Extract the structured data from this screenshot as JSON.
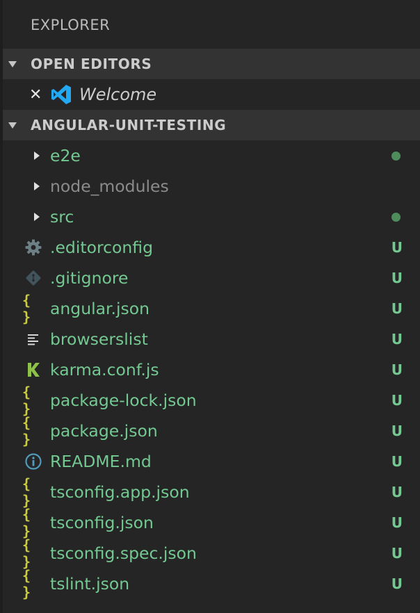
{
  "explorer": {
    "title": "EXPLORER"
  },
  "open_editors": {
    "header": "OPEN EDITORS",
    "items": [
      {
        "label": "Welcome",
        "icon": "vscode-logo-icon",
        "close_icon": "close-icon"
      }
    ]
  },
  "project": {
    "header": "ANGULAR-UNIT-TESTING",
    "items": [
      {
        "label": "e2e",
        "type": "folder",
        "icon": "chevron-right-icon",
        "decoration": "dot",
        "color": "#73c991"
      },
      {
        "label": "node_modules",
        "type": "folder",
        "icon": "chevron-right-icon",
        "decoration": "",
        "color": "#8b8b8b"
      },
      {
        "label": "src",
        "type": "folder",
        "icon": "chevron-right-icon",
        "decoration": "dot",
        "color": "#73c991"
      },
      {
        "label": ".editorconfig",
        "type": "file",
        "icon": "gear-icon",
        "decoration": "U"
      },
      {
        "label": ".gitignore",
        "type": "file",
        "icon": "git-icon",
        "decoration": "U"
      },
      {
        "label": "angular.json",
        "type": "file",
        "icon": "json-braces-icon",
        "decoration": "U"
      },
      {
        "label": "browserslist",
        "type": "file",
        "icon": "text-lines-icon",
        "decoration": "U"
      },
      {
        "label": "karma.conf.js",
        "type": "file",
        "icon": "karma-icon",
        "decoration": "U"
      },
      {
        "label": "package-lock.json",
        "type": "file",
        "icon": "json-braces-icon",
        "decoration": "U"
      },
      {
        "label": "package.json",
        "type": "file",
        "icon": "json-braces-icon",
        "decoration": "U"
      },
      {
        "label": "README.md",
        "type": "file",
        "icon": "info-icon",
        "decoration": "U"
      },
      {
        "label": "tsconfig.app.json",
        "type": "file",
        "icon": "json-braces-icon",
        "decoration": "U"
      },
      {
        "label": "tsconfig.json",
        "type": "file",
        "icon": "json-braces-icon",
        "decoration": "U"
      },
      {
        "label": "tsconfig.spec.json",
        "type": "file",
        "icon": "json-braces-icon",
        "decoration": "U"
      },
      {
        "label": "tslint.json",
        "type": "file",
        "icon": "json-braces-icon",
        "decoration": "U"
      }
    ]
  },
  "colors": {
    "background": "#252526",
    "section_header": "#333333",
    "untracked_green": "#73c991",
    "json_yellow": "#cbcb41",
    "vscode_blue": "#23a9f2"
  }
}
